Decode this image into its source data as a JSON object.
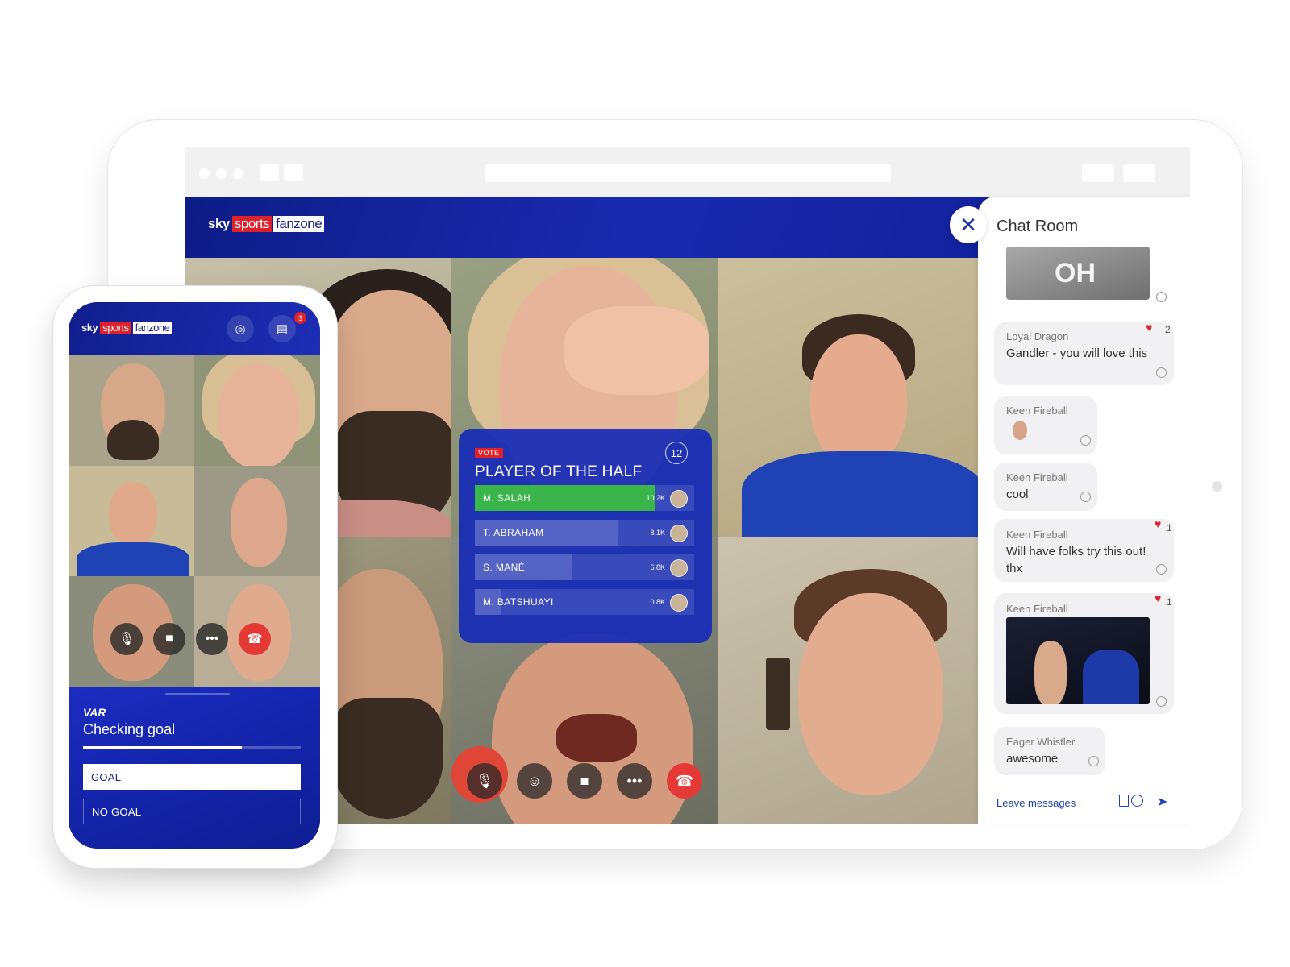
{
  "brand": {
    "sky": "sky",
    "sports": "sports",
    "fanzone": "fanzone"
  },
  "vote": {
    "badge": "VOTE",
    "title": "PLAYER OF THE HALF",
    "count": "12",
    "options": [
      {
        "name": "M. SALAH",
        "value": "10.2K",
        "share": 0.82,
        "leading": true
      },
      {
        "name": "T. ABRAHAM",
        "value": "8.1K",
        "share": 0.65,
        "leading": false
      },
      {
        "name": "S. MANÉ",
        "value": "6.8K",
        "share": 0.44,
        "leading": false
      },
      {
        "name": "M. BATSHUAYI",
        "value": "0.8K",
        "share": 0.12,
        "leading": false
      }
    ]
  },
  "chat": {
    "title": "Chat Room",
    "gif_caption": "OH",
    "messages": [
      {
        "name": "Loyal Dragon",
        "text": "Gandler - you will love this",
        "likes": "2"
      },
      {
        "name": "Keen Fireball",
        "text": ""
      },
      {
        "name": "Keen Fireball",
        "text": "cool"
      },
      {
        "name": "Keen Fireball",
        "text": "Will have folks try this out! thx",
        "likes": "1"
      },
      {
        "name": "Keen Fireball",
        "text": "",
        "likes": "1"
      },
      {
        "name": "Eager Whistler",
        "text": "awesome"
      }
    ],
    "input_placeholder": "Leave messages"
  },
  "phone": {
    "notification_count": "3",
    "var": {
      "label": "VAR",
      "title": "Checking goal",
      "progress": 0.73,
      "options": [
        "GOAL",
        "NO GOAL"
      ]
    }
  },
  "colors": {
    "brand_blue": "#142191",
    "accent_red": "#e0202b",
    "vote_green": "#3ab54a",
    "link_blue": "#1c3fb8"
  },
  "icons": [
    "mic-icon",
    "camera-icon",
    "sticker-icon",
    "more-icon",
    "end-call-icon",
    "close-icon",
    "send-icon",
    "headset-icon",
    "chat-icon"
  ]
}
